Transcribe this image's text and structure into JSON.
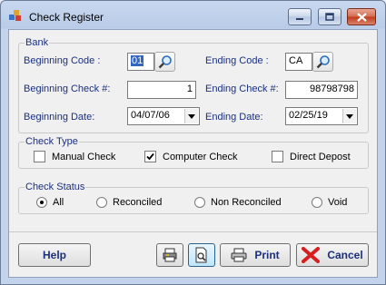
{
  "window": {
    "title": "Check Register",
    "buttons": {
      "minimize": "minimize-icon",
      "maximize": "maximize-icon",
      "close": "close-icon"
    }
  },
  "bank": {
    "legend": "Bank",
    "beginning_code_label": "Beginning Code :",
    "beginning_code_value": "01",
    "ending_code_label": "Ending Code :",
    "ending_code_value": "CA",
    "beginning_check_label": "Beginning Check #:",
    "beginning_check_value": "1",
    "ending_check_label": "Ending Check #:",
    "ending_check_value": "98798798",
    "beginning_date_label": "Beginning Date:",
    "beginning_date_value": "04/07/06",
    "ending_date_label": "Ending Date:",
    "ending_date_value": "02/25/19"
  },
  "check_type": {
    "legend": "Check Type",
    "options": [
      {
        "label": "Manual Check",
        "checked": false
      },
      {
        "label": "Computer Check",
        "checked": true
      },
      {
        "label": "Direct Depost",
        "checked": false
      }
    ]
  },
  "check_status": {
    "legend": "Check Status",
    "options": [
      {
        "label": "All",
        "selected": true
      },
      {
        "label": "Reconciled",
        "selected": false
      },
      {
        "label": "Non Reconciled",
        "selected": false
      },
      {
        "label": "Void",
        "selected": false
      }
    ]
  },
  "actions": {
    "help": "Help",
    "print": "Print",
    "cancel": "Cancel"
  },
  "colors": {
    "label_blue": "#1c2f7c",
    "cancel_red": "#d61f1f",
    "selection": "#3166c4"
  }
}
